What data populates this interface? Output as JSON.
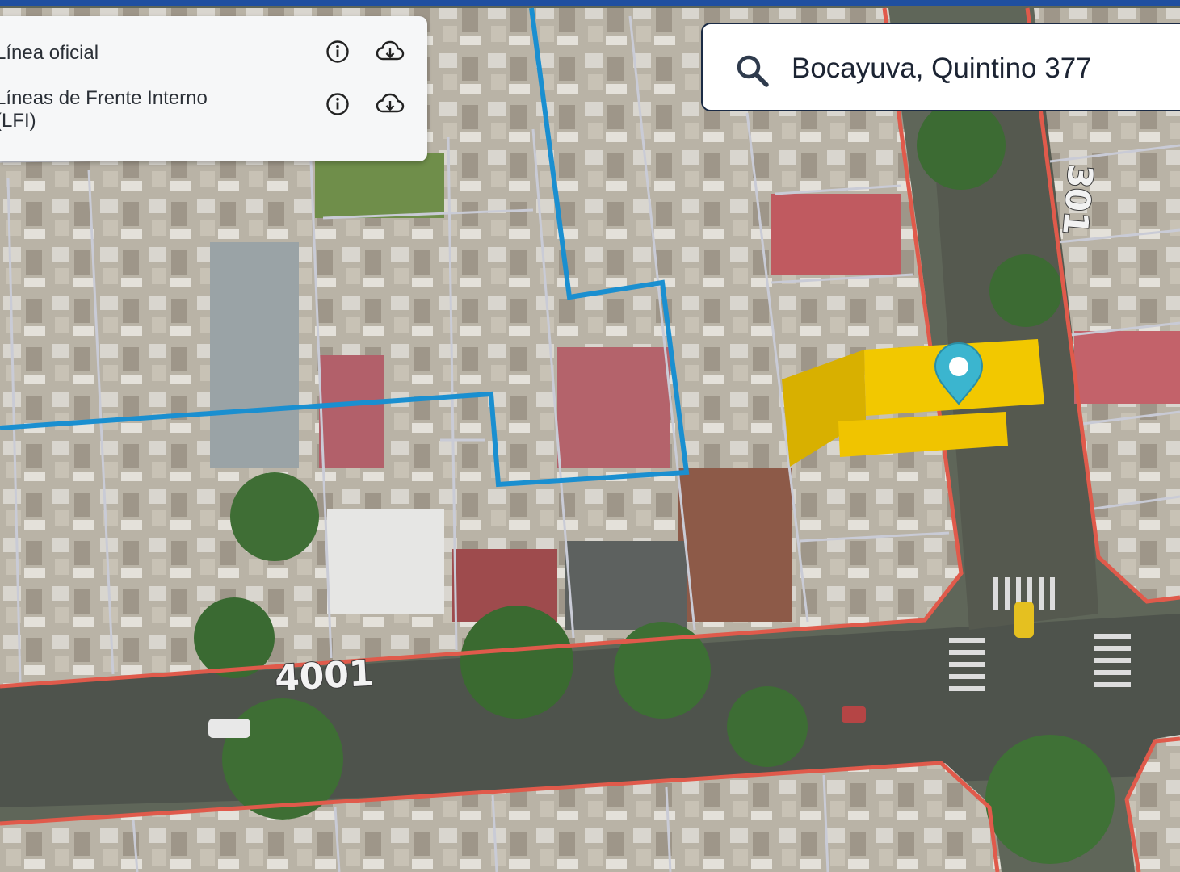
{
  "map": {
    "street_numbers": [
      "4001",
      "301"
    ],
    "colors": {
      "block_boundary": "#e05a4b",
      "zone_boundary": "#1a8fd0",
      "parcel_line": "#c9cbd6",
      "selected_parcel": "#f2c500",
      "marker": "#3bb5cf"
    }
  },
  "layers": [
    {
      "label": "Línea oficial",
      "info_icon": "info-icon",
      "download_icon": "cloud-download-icon"
    },
    {
      "label": "Líneas de Frente Interno (LFI)",
      "info_icon": "info-icon",
      "download_icon": "cloud-download-icon"
    }
  ],
  "search": {
    "value": "Bocayuva, Quintino 377",
    "icon": "search-icon"
  }
}
